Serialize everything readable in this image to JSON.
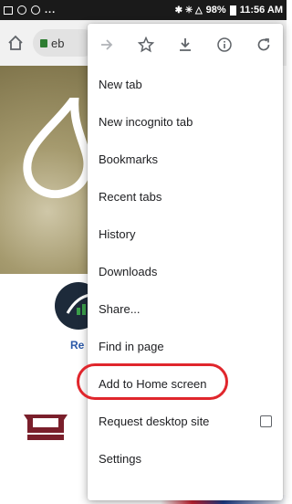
{
  "status_bar": {
    "left_icons": [
      "image-icon",
      "settings-circle-icon",
      "circle-icon"
    ],
    "dots": "...",
    "indicators": "✱ ✳ △",
    "battery": "98%",
    "time": "11:56 AM"
  },
  "toolbar": {
    "url_text": "eb"
  },
  "page": {
    "partial_link": "Re"
  },
  "menu": {
    "top_icons": [
      "forward-icon",
      "star-icon",
      "download-icon",
      "info-icon",
      "refresh-icon"
    ],
    "items": [
      {
        "label": "New tab"
      },
      {
        "label": "New incognito tab"
      },
      {
        "label": "Bookmarks"
      },
      {
        "label": "Recent tabs"
      },
      {
        "label": "History"
      },
      {
        "label": "Downloads"
      },
      {
        "label": "Share..."
      },
      {
        "label": "Find in page"
      },
      {
        "label": "Add to Home screen"
      },
      {
        "label": "Request desktop site"
      },
      {
        "label": "Settings"
      }
    ]
  },
  "colors": {
    "highlight": "#e0262c",
    "lock": "#2e7d32",
    "link": "#2b59a8"
  }
}
